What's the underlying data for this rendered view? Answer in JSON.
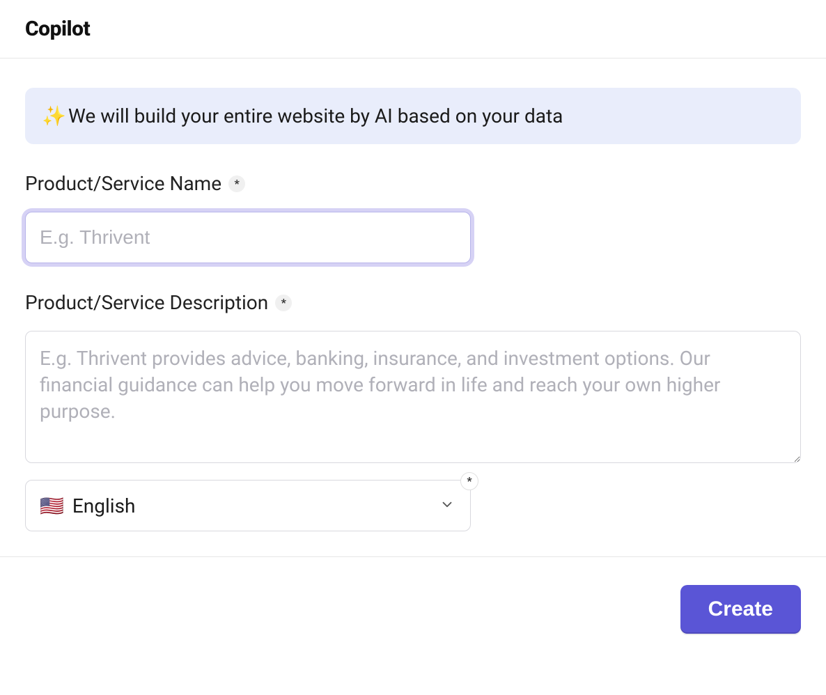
{
  "header": {
    "title": "Copilot"
  },
  "banner": {
    "icon_name": "sparkles-icon",
    "icon_glyph": "✨",
    "text": "We will build your entire website by AI based on your data"
  },
  "fields": {
    "name": {
      "label": "Product/Service Name",
      "required_mark": "*",
      "placeholder": "E.g. Thrivent",
      "value": ""
    },
    "description": {
      "label": "Product/Service Description",
      "required_mark": "*",
      "placeholder": "E.g. Thrivent provides advice, banking, insurance, and investment options. Our financial guidance can help you move forward in life and reach your own higher purpose.",
      "value": ""
    },
    "language": {
      "required_mark": "*",
      "selected_flag": "🇺🇸",
      "selected_label": "English"
    }
  },
  "actions": {
    "create_label": "Create"
  }
}
